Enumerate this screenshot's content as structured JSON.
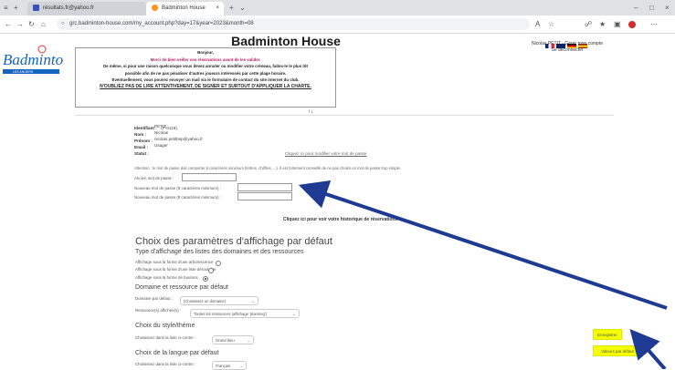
{
  "browser": {
    "tab1_label": "résultats.fr@yahoo.fr",
    "tab2_label": "Badminton House",
    "url": "grc.badminton-house.com/my_account.php?day=17&year=2023&month=08",
    "colors": {
      "tab1_fav": "#3f51b5",
      "tab2_fav": "#f7931e"
    }
  },
  "header": {
    "site_title": "Badminton House",
    "logo_text": "Badminton",
    "user_name": "Nicolas PETIT - Gérer mon compte",
    "logout": "Se déconnecter"
  },
  "notice": {
    "greeting": "Bonjour,",
    "line1": "Merci de bien veiller vos réservations avant de les valider.",
    "line2": "De même, si pour une raison quelconque vous devez annuler ou modifier votre créneau, faites-le le plus tôt",
    "line3": "possible afin de ne pas pénaliser d'autres joueurs intéressés par cette plage horaire.",
    "line4": "Éventuellement, vous pouvez envoyer un mail via le formulaire de contact du site internet du club.",
    "line5": "N'OUBLIEZ PAS DE LIRE ATTENTIVEMENT, DE SIGNER ET SURTOUT D'APPLIQUER LA CHARTE."
  },
  "sort_arrows": "↑↓",
  "profile": {
    "identifier_label": "Identifiant :",
    "identifier_value": "(P-0119)",
    "name_label": "Nom :",
    "name_value": "PETIT",
    "firstname_label": "Prénom :",
    "firstname_value": "Nicolas",
    "email_label": "Email :",
    "email_value": "nicolas.petitbsp@yahoo.fr",
    "status_label": "Statut :",
    "status_value": "Usager"
  },
  "password": {
    "change_link": "Cliquez ici pour modifier votre mot de passe",
    "hint": "Attention : le mot de passe doit comporter 8 caractères minimum (lettres, chiffres, ...). Il est fortement conseillé de ne pas choisir un mot de passe trop simple.",
    "old_label": "Ancien mot de passe :",
    "new_label": "Nouveau mot de passe (8 caractères minimum) :",
    "confirm_label": "Nouveau mot de passe (8 caractères minimum) :"
  },
  "history_link": "Cliquez ici pour voir votre historique de réservations",
  "prefs": {
    "title": "Choix des paramètres d'affichage par défaut",
    "display_subtitle": "Type d'affichage des listes des domaines et des ressources",
    "opt1": "Affichage sous la forme d'une arborescence",
    "opt2": "Affichage sous la forme d'une liste déroulante",
    "opt3": "Affichage sous la forme de boutons",
    "domain_subtitle": "Domaine et ressource par défaut",
    "domain_label": "Domaine par défaut :",
    "domain_value": "(Choisissez un domaine)",
    "resource_label": "Ressource(s) affichée(s) :",
    "resource_value": "Toutes les ressources (affichage 'planning')",
    "style_subtitle": "Choix du style/thème",
    "style_label": "Choisissez dans la liste ci-contre :",
    "style_value": "Grand bleu",
    "lang_subtitle": "Choix de la langue par défaut",
    "lang_label": "Choisissez dans la liste ci-contre :",
    "lang_value": "Français"
  },
  "buttons": {
    "save": "Enregistrer",
    "defaults": "Valeurs par défaut"
  },
  "annotation_color": "#1f3a93"
}
